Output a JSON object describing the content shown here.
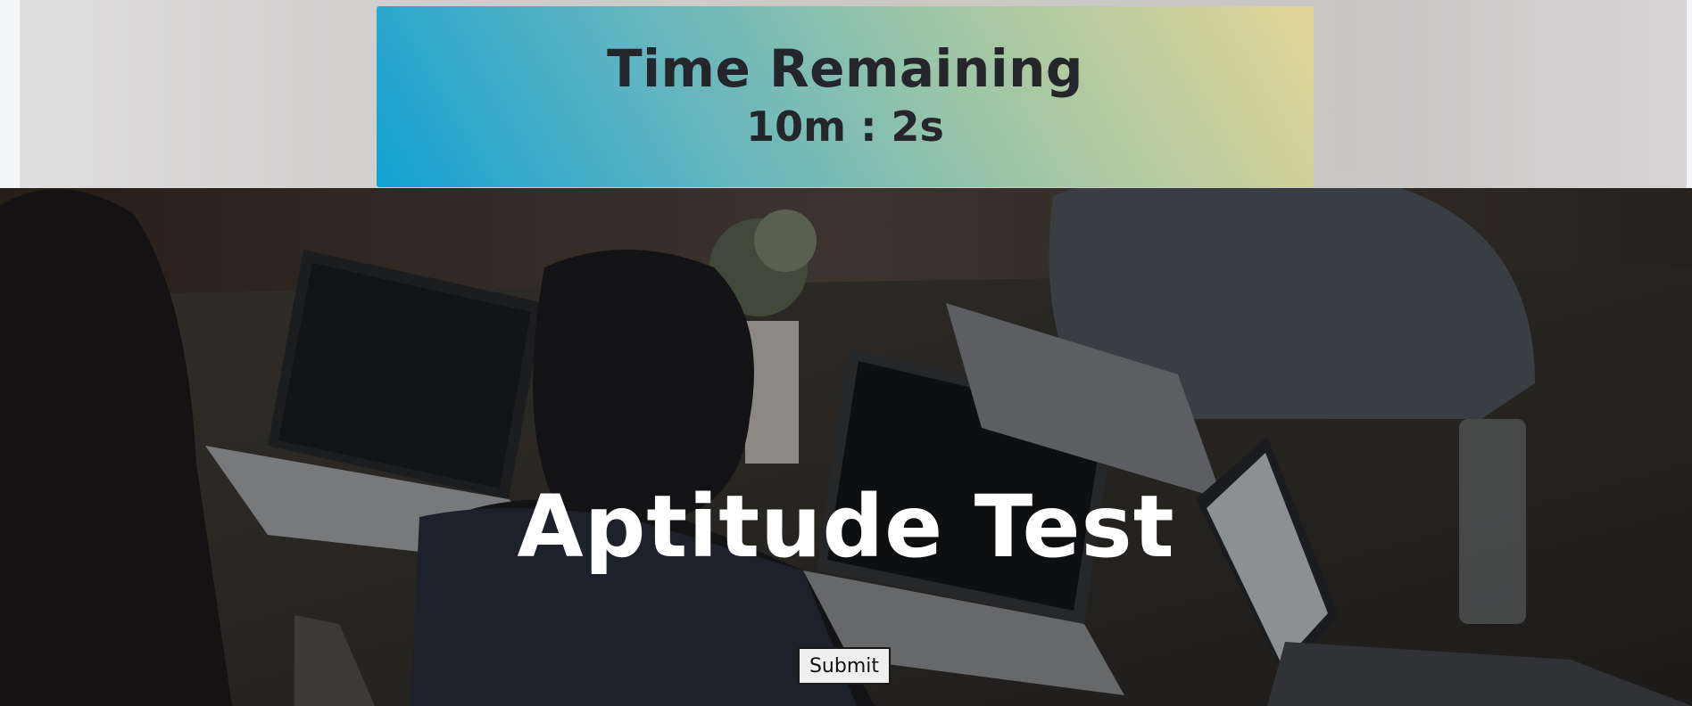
{
  "timer": {
    "title": "Time Remaining",
    "value": "10m : 2s"
  },
  "hero": {
    "title": "Aptitude Test"
  },
  "form": {
    "submit_label": "Submit"
  },
  "colors": {
    "timer_gradient_start": "#12a2d3",
    "timer_gradient_end": "#e3d596",
    "timer_text": "#25262b",
    "hero_text": "#ffffff"
  }
}
